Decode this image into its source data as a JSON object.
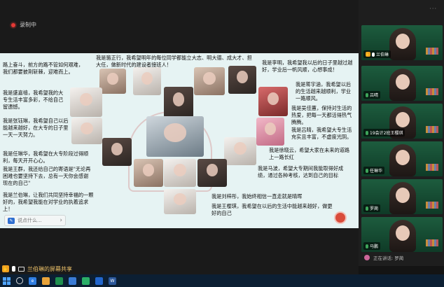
{
  "meeting": {
    "status_text": "录制中",
    "share_label": "兰伯琳的屏幕共享",
    "speaking_label": "正在讲话: 罗蔺"
  },
  "slide": {
    "paragraphs": [
      "我是骆正行，我希望明年的每位同学都能立大志、明大德、成大才、担大任，做新时代的建设者接班人！",
      "路上奋斗，前方的路不管如何艰难，我们都要披荆斩棘，迎难而上。",
      "我是盛嘉禧，我希望我的大专生活丰富多彩，不给自己留遗憾。",
      "我是张钰琳，我希望自己以后能越来越好，在大专的日子里一天一天努力。",
      "我是任琳华，我希望在大专阶段过得顺利，每天开开心心。",
      "我是王群，我还给自己的寄语是\"无论再困难也要坚持下去，总有一天你会感谢现在的自己\"",
      "我是兰伯琳，让我们共同坚持幸福的一颗好的，我希望我能在对学业的执着追求上！",
      "我是李明，我希望我以后的日子里越过越好，学业后一帆风顺，心想事成！",
      "我是蒋宇涵，我希望以后的生活越来越顺利，学业一路顺风。",
      "我是吴佳蕙，保持对生活的热爱，把每一天都活得热气腾腾。",
      "我是吕晴，我希望大专生活充实且丰富，不虚度光阴。",
      "我是徐晓云，希望大家在未来的道路上一路长红",
      "我是马波，希望大专期间我能取得好成绩，通过各种考核，达到自己的目标",
      "我是刘梓彤，我始终相信一直走就是晴晖",
      "我是王樱琪，我希望在以后的生活中能越来越好，做更好的自己"
    ],
    "comment_placeholder": "说点什么..."
  },
  "participants": [
    {
      "name": "兰伯琳",
      "raised_hand": true,
      "mic": "on"
    },
    {
      "name": "吕晴",
      "raised_hand": false,
      "mic": "off"
    },
    {
      "name": "19会计2班王樱琪",
      "raised_hand": false,
      "mic": "off"
    },
    {
      "name": "任琳华",
      "raised_hand": false,
      "mic": "off"
    },
    {
      "name": "罗蔺",
      "raised_hand": false,
      "mic": "speaking"
    },
    {
      "name": "马鹏",
      "raised_hand": false,
      "mic": "off"
    }
  ],
  "colors": {
    "slide_bg": "#e6f3f3",
    "accent_red": "#c74a4a",
    "board_green": "#1d5c3e",
    "share_text": "#f0c46a"
  }
}
